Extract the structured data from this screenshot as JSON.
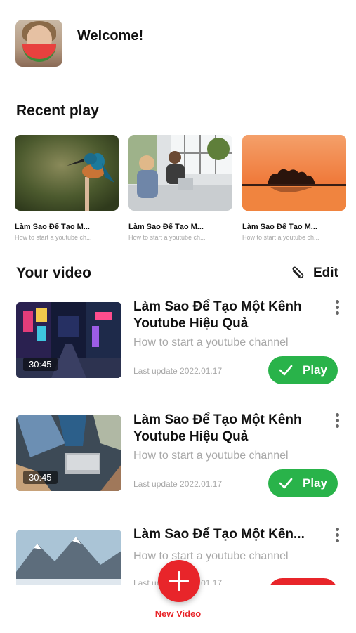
{
  "header": {
    "welcome": "Welcome!"
  },
  "recent": {
    "title": "Recent play",
    "items": [
      {
        "title": "Làm Sao Để Tạo M...",
        "subtitle": "How to start a youtube ch..."
      },
      {
        "title": "Làm Sao Để Tạo M...",
        "subtitle": "How to start a youtube ch..."
      },
      {
        "title": "Làm Sao Để Tạo M...",
        "subtitle": "How to start a youtube ch..."
      }
    ]
  },
  "your_video": {
    "title": "Your video",
    "edit_label": "Edit",
    "items": [
      {
        "title": "Làm Sao Để Tạo Một Kênh Youtube Hiệu Quả",
        "subtitle": "How to start a youtube channel",
        "date": "Last update 2022.01.17",
        "duration": "30:45",
        "play_label": "Play"
      },
      {
        "title": "Làm Sao Để Tạo Một Kênh Youtube Hiệu Quả",
        "subtitle": "How to start a youtube channel",
        "date": "Last update 2022.01.17",
        "duration": "30:45",
        "play_label": "Play"
      },
      {
        "title": "Làm Sao Để Tạo Một Kên...",
        "subtitle": "How to start a youtube channel",
        "date": "Last update 2022.01.17"
      }
    ]
  },
  "bottom": {
    "new_video_label": "New Video"
  },
  "colors": {
    "accent_green": "#29b34a",
    "accent_red": "#e8252a",
    "muted_text": "#a8a8a8"
  }
}
